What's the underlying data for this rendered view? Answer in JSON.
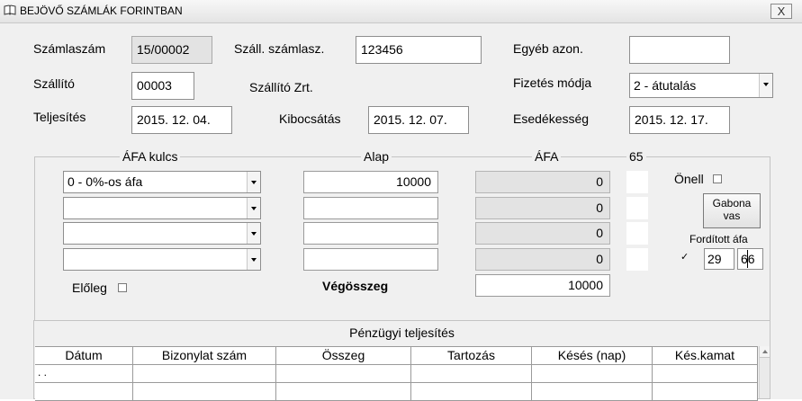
{
  "window": {
    "title": "BEJÖVŐ SZÁMLÁK FORINTBAN",
    "close_symbol": "X"
  },
  "header": {
    "szamlaszam_label": "Számlaszám",
    "szamlaszam_value": "15/00002",
    "szall_szamlasz_label": "Száll. számlasz.",
    "szall_szamlasz_value": "123456",
    "egyeb_azon_label": "Egyéb azon.",
    "egyeb_azon_value": "",
    "szallito_label": "Szállító",
    "szallito_code": "00003",
    "szallito_name": "Szállító Zrt.",
    "fizetes_modja_label": "Fizetés módja",
    "fizetes_modja_value": "2 - átutalás",
    "teljesites_label": "Teljesítés",
    "teljesites_value": "2015. 12. 04.",
    "kibocsatas_label": "Kibocsátás",
    "kibocsatas_value": "2015. 12. 07.",
    "esedekesseg_label": "Esedékesség",
    "esedekesseg_value": "2015. 12. 17."
  },
  "vat": {
    "col_afa_kulcs": "ÁFA kulcs",
    "col_alap": "Alap",
    "col_afa": "ÁFA",
    "col_65": "65",
    "rows": [
      {
        "kulcs": "0  - 0%-os áfa",
        "alap": "10000",
        "afa": "0"
      },
      {
        "kulcs": "",
        "alap": "",
        "afa": "0"
      },
      {
        "kulcs": "",
        "alap": "",
        "afa": "0"
      },
      {
        "kulcs": "",
        "alap": "",
        "afa": "0"
      }
    ],
    "onell_label": "Önell",
    "onell_checked": false,
    "gabona_button": "Gabona vas",
    "forditott_label": "Fordított áfa",
    "forditott_checked": true,
    "check_mark": "✓",
    "forditott_val1": "29",
    "forditott_val2": "66",
    "eloleg_label": "Előleg",
    "eloleg_checked": false,
    "vegosszeg_label": "Végösszeg",
    "vegosszeg_value": "10000"
  },
  "financial": {
    "title": "Pénzügyi teljesítés",
    "columns": [
      "Dátum",
      "Bizonylat szám",
      "Összeg",
      "Tartozás",
      "Késés (nap)",
      "Kés.kamat"
    ],
    "row1_datum": ". ."
  },
  "colors": {
    "readonly_bg": "#e3e3e3",
    "window_bg": "#f0f0f0"
  }
}
